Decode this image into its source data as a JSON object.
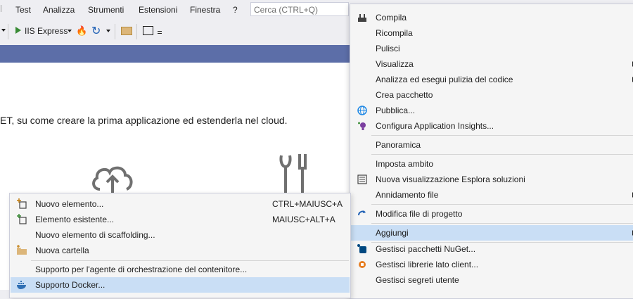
{
  "menubar": {
    "items": [
      "Test",
      "Analizza",
      "Strumenti",
      "Estensioni",
      "Finestra",
      "?"
    ],
    "search_placeholder": "Cerca (CTRL+Q)"
  },
  "toolbar": {
    "run_label": "IIS Express"
  },
  "content": {
    "text": "ET, su come creare la prima applicazione ed estenderla nel cloud."
  },
  "context_menu_right": {
    "items": [
      {
        "label": "Compila",
        "icon": "build-icon"
      },
      {
        "label": "Ricompila"
      },
      {
        "label": "Pulisci"
      },
      {
        "label": "Visualizza",
        "submenu": true
      },
      {
        "label": "Analizza ed esegui pulizia del codice",
        "submenu": true
      },
      {
        "label": "Crea pacchetto"
      },
      {
        "label": "Pubblica...",
        "icon": "globe-icon"
      },
      {
        "label": "Configura Application Insights...",
        "icon": "lightbulb-icon"
      },
      {
        "label": "Panoramica"
      },
      {
        "label": "Imposta ambito"
      },
      {
        "label": "Nuova visualizzazione Esplora soluzioni",
        "icon": "solution-explorer-icon"
      },
      {
        "label": "Annidamento file",
        "submenu": true
      },
      {
        "label": "Modifica file di progetto",
        "icon": "refresh-arrow-icon"
      },
      {
        "label": "Aggiungi",
        "submenu": true,
        "highlighted": true
      },
      {
        "label": "Gestisci pacchetti NuGet...",
        "icon": "nuget-icon"
      },
      {
        "label": "Gestisci librerie lato client...",
        "icon": "client-library-icon"
      },
      {
        "label": "Gestisci segreti utente"
      }
    ]
  },
  "context_menu_left": {
    "items": [
      {
        "label": "Nuovo elemento...",
        "shortcut": "CTRL+MAIUSC+A",
        "icon": "new-item-icon"
      },
      {
        "label": "Elemento esistente...",
        "shortcut": "MAIUSC+ALT+A",
        "icon": "existing-item-icon"
      },
      {
        "label": "Nuovo elemento di scaffolding...",
        "shortcut": ""
      },
      {
        "label": "Nuova cartella",
        "shortcut": "",
        "icon": "folder-icon"
      },
      {
        "label": "Supporto per l'agente di orchestrazione del contenitore...",
        "shortcut": ""
      },
      {
        "label": "Supporto Docker...",
        "shortcut": "",
        "highlighted": true,
        "icon": "docker-icon"
      }
    ]
  },
  "colors": {
    "band": "#5c6ea8",
    "highlight": "#c9def5",
    "menu_bg": "#f5f5f5"
  }
}
